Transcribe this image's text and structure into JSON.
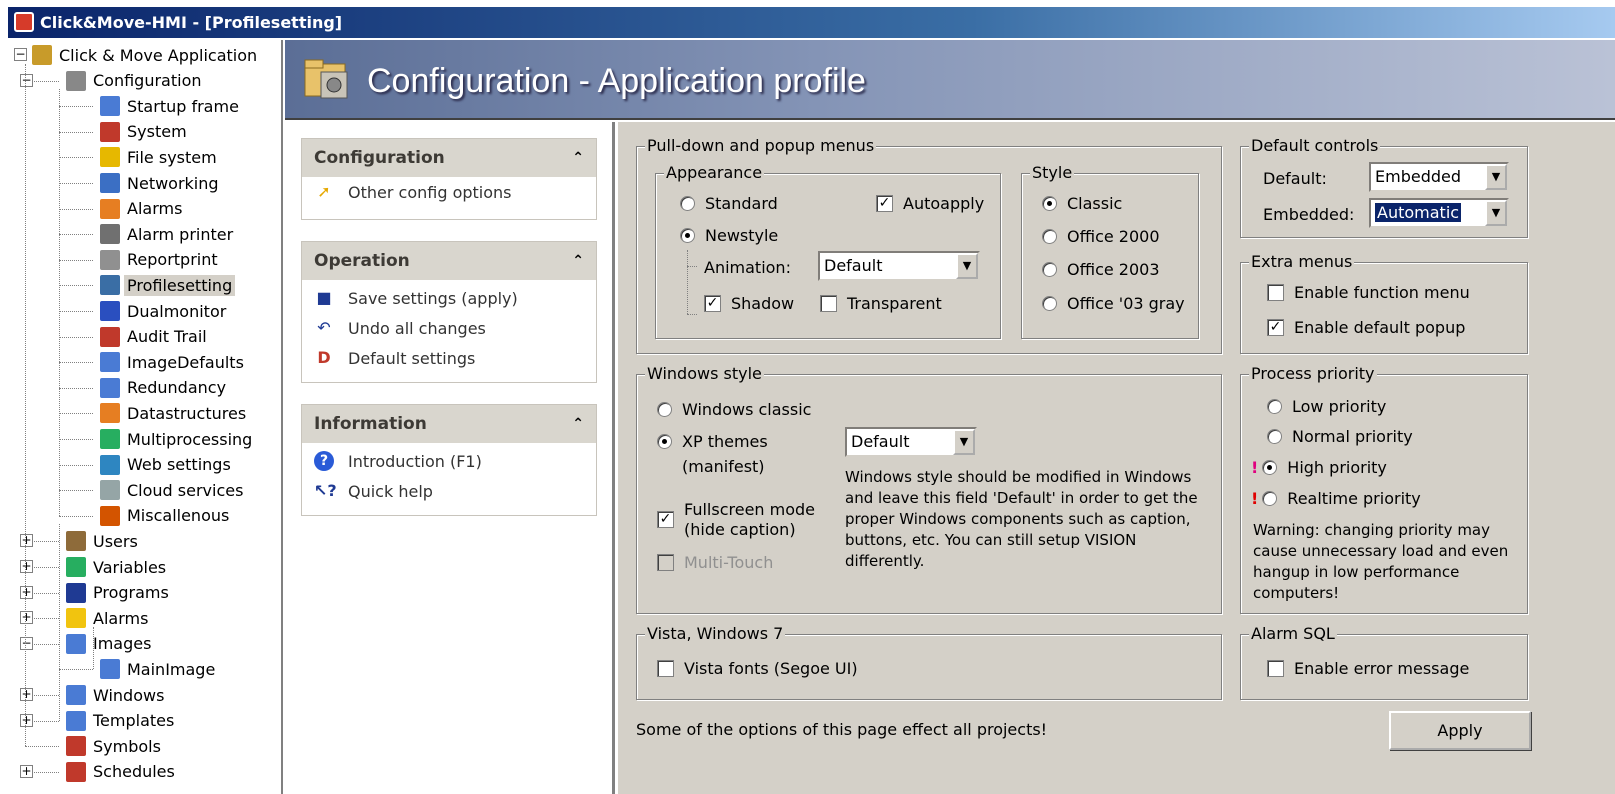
{
  "window": {
    "title": "Click&Move-HMI - [Profilesetting]"
  },
  "tree": [
    {
      "label": "Click & Move Application",
      "level": 0,
      "exp": "−",
      "color": "#c89b2a",
      "icon": "project-icon"
    },
    {
      "label": "Configuration",
      "level": 1,
      "exp": "−",
      "color": "#888",
      "icon": "tools-icon"
    },
    {
      "label": "Startup frame",
      "level": 2,
      "color": "#4a7bd4",
      "icon": "window-icon"
    },
    {
      "label": "System",
      "level": 2,
      "color": "#c0392b",
      "icon": "system-icon"
    },
    {
      "label": "File system",
      "level": 2,
      "color": "#e6b800",
      "icon": "database-icon"
    },
    {
      "label": "Networking",
      "level": 2,
      "color": "#3b6fc4",
      "icon": "network-icon"
    },
    {
      "label": "Alarms",
      "level": 2,
      "color": "#e67e22",
      "icon": "alarm-icon"
    },
    {
      "label": "Alarm printer",
      "level": 2,
      "color": "#707070",
      "icon": "printer-icon"
    },
    {
      "label": "Reportprint",
      "level": 2,
      "color": "#909090",
      "icon": "report-icon"
    },
    {
      "label": "Profilesetting",
      "level": 2,
      "color": "#3a6ea5",
      "icon": "profile-icon",
      "selected": true
    },
    {
      "label": "Dualmonitor",
      "level": 2,
      "color": "#2a4fbf",
      "icon": "monitor-icon"
    },
    {
      "label": "Audit Trail",
      "level": 2,
      "color": "#c0392b",
      "icon": "audit-icon"
    },
    {
      "label": "ImageDefaults",
      "level": 2,
      "color": "#4a7bd4",
      "icon": "image-icon"
    },
    {
      "label": "Redundancy",
      "level": 2,
      "color": "#4a7bd4",
      "icon": "redundancy-icon"
    },
    {
      "label": "Datastructures",
      "level": 2,
      "color": "#e67e22",
      "icon": "datastructure-icon"
    },
    {
      "label": "Multiprocessing",
      "level": 2,
      "color": "#27ae60",
      "icon": "multiprocessing-icon"
    },
    {
      "label": "Web settings",
      "level": 2,
      "color": "#2e86c1",
      "icon": "globe-icon"
    },
    {
      "label": "Cloud services",
      "level": 2,
      "color": "#95a5a6",
      "icon": "cloud-icon"
    },
    {
      "label": "Miscallenous",
      "level": 2,
      "color": "#d35400",
      "icon": "misc-icon"
    },
    {
      "label": "Users",
      "level": 1,
      "exp": "+",
      "color": "#8e6b3a",
      "icon": "users-icon"
    },
    {
      "label": "Variables",
      "level": 1,
      "exp": "+",
      "color": "#27ae60",
      "icon": "variables-icon"
    },
    {
      "label": "Programs",
      "level": 1,
      "exp": "+",
      "color": "#1f3a93",
      "icon": "programs-icon"
    },
    {
      "label": "Alarms",
      "level": 1,
      "exp": "+",
      "color": "#f1c40f",
      "icon": "lightning-icon"
    },
    {
      "label": "Images",
      "level": 1,
      "exp": "−",
      "color": "#4a7bd4",
      "icon": "images-icon"
    },
    {
      "label": "MainImage",
      "level": 2,
      "color": "#4a7bd4",
      "icon": "image-icon"
    },
    {
      "label": "Windows",
      "level": 1,
      "exp": "+",
      "color": "#4a7bd4",
      "icon": "windows-icon"
    },
    {
      "label": "Templates",
      "level": 1,
      "exp": "+",
      "color": "#4a7bd4",
      "icon": "templates-icon"
    },
    {
      "label": "Symbols",
      "level": 1,
      "color": "#c0392b",
      "icon": "symbols-icon"
    },
    {
      "label": "Schedules",
      "level": 1,
      "exp": "+",
      "color": "#c0392b",
      "icon": "schedules-icon"
    }
  ],
  "header": {
    "title": "Configuration - Application profile"
  },
  "tasks": {
    "configuration": {
      "title": "Configuration",
      "items": [
        "Other config options"
      ]
    },
    "operation": {
      "title": "Operation",
      "items": [
        "Save settings (apply)",
        "Undo all changes",
        "Default settings"
      ]
    },
    "information": {
      "title": "Information",
      "items": [
        "Introduction (F1)",
        "Quick help"
      ]
    }
  },
  "pulldown": {
    "title": "Pull-down and popup menus",
    "appearance": {
      "title": "Appearance",
      "standard": "Standard",
      "newstyle": "Newstyle",
      "autoapply": "Autoapply",
      "animation_label": "Animation:",
      "animation_value": "Default",
      "shadow": "Shadow",
      "transparent": "Transparent"
    },
    "style": {
      "title": "Style",
      "options": [
        "Classic",
        "Office 2000",
        "Office 2003",
        "Office '03 gray"
      ]
    }
  },
  "default_controls": {
    "title": "Default controls",
    "default_label": "Default:",
    "default_value": "Embedded",
    "embedded_label": "Embedded:",
    "embedded_value": "Automatic"
  },
  "extra_menus": {
    "title": "Extra menus",
    "function_menu": "Enable function menu",
    "default_popup": "Enable default popup"
  },
  "windows_style": {
    "title": "Windows style",
    "classic": "Windows classic",
    "xp1": "XP themes",
    "xp2": "(manifest)",
    "xp_value": "Default",
    "note": "Windows style should be modified in Windows and leave this field 'Default' in order to get the proper Windows components such as caption, buttons, etc. You can still setup VISION differently.",
    "fullscreen1": "Fullscreen mode",
    "fullscreen2": "(hide caption)",
    "multitouch": "Multi-Touch"
  },
  "process_priority": {
    "title": "Process priority",
    "options": [
      "Low priority",
      "Normal priority",
      "High priority",
      "Realtime priority"
    ],
    "warning": "Warning: changing priority may cause unnecessary load and even hangup in low performance computers!"
  },
  "vista": {
    "title": "Vista, Windows 7",
    "fonts": "Vista fonts (Segoe UI)"
  },
  "alarm_sql": {
    "title": "Alarm SQL",
    "error_message": "Enable error message"
  },
  "footer": {
    "note": "Some of the options of this page effect all projects!",
    "apply": "Apply"
  },
  "marks": {
    "checked": "✓",
    "exclaim": "!",
    "dropdown": "▼",
    "collapse": "⌃"
  }
}
